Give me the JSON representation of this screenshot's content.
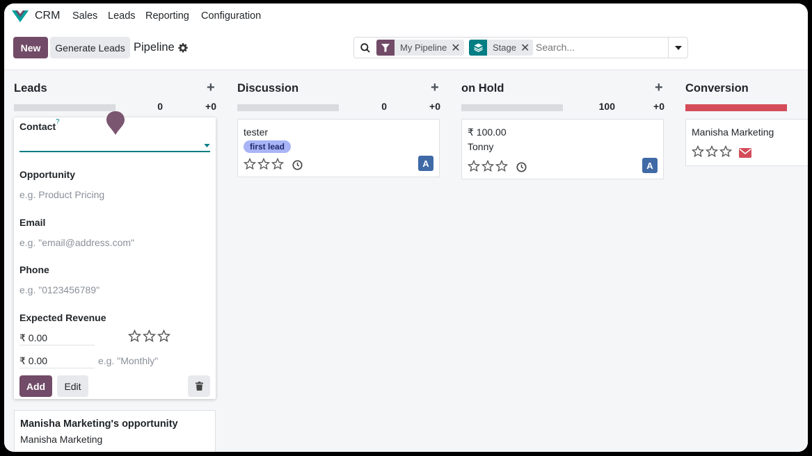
{
  "nav": {
    "app_name": "CRM",
    "items": [
      "Sales",
      "Leads",
      "Reporting",
      "Configuration"
    ]
  },
  "toolbar": {
    "new_label": "New",
    "generate_label": "Generate Leads",
    "page_title": "Pipeline"
  },
  "search": {
    "facets": [
      {
        "label": "My Pipeline",
        "icon": "filter-icon",
        "color": "#714B67"
      },
      {
        "label": "Stage",
        "icon": "layers-icon",
        "color": "#017e84"
      }
    ],
    "placeholder": "Search..."
  },
  "columns": [
    {
      "title": "Leads",
      "count": "0",
      "plus_count": "+0",
      "progress_color": "#d9dbde"
    },
    {
      "title": "Discussion",
      "count": "0",
      "plus_count": "+0",
      "progress_color": "#d9dbde"
    },
    {
      "title": "on Hold",
      "count": "100",
      "plus_count": "+0",
      "progress_color": "#d9dbde"
    },
    {
      "title": "Conversion",
      "count": "",
      "plus_count": "",
      "progress_color": "#d44c59"
    }
  ],
  "cards": {
    "discussion": {
      "contact": "tester",
      "tag": "first lead",
      "avatar": "A"
    },
    "on_hold": {
      "revenue": "₹ 100.00",
      "contact": "Tonny",
      "avatar": "A"
    },
    "conversion": {
      "contact": "Manisha Marketing"
    },
    "leads_bottom": {
      "title": "Manisha Marketing's opportunity",
      "contact": "Manisha Marketing"
    }
  },
  "quick_create": {
    "contact_label": "Contact",
    "contact_help": "?",
    "opportunity_label": "Opportunity",
    "opportunity_placeholder": "e.g. Product Pricing",
    "email_label": "Email",
    "email_placeholder": "e.g. \"email@address.com\"",
    "phone_label": "Phone",
    "phone_placeholder": "e.g. \"0123456789\"",
    "revenue_label": "Expected Revenue",
    "revenue_value": "₹ 0.00",
    "recurring_value": "₹ 0.00",
    "recurring_placeholder": "e.g. \"Monthly\"",
    "add_label": "Add",
    "edit_label": "Edit"
  },
  "colors": {
    "primary": "#714B67",
    "accent_teal": "#017e84",
    "avatar": "#3f6aa6",
    "danger": "#d44c59"
  }
}
